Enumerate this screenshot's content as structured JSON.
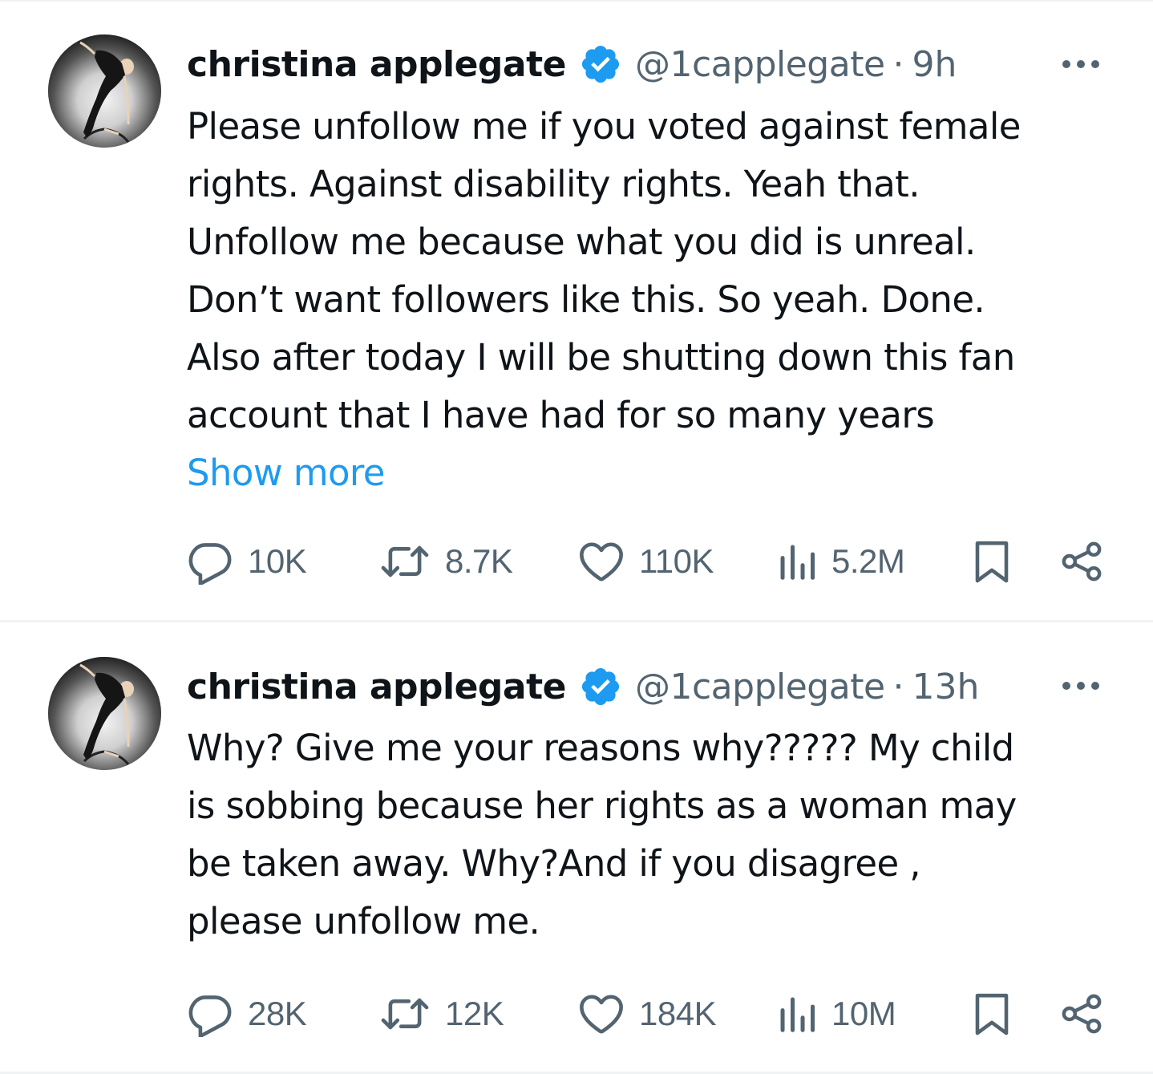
{
  "tweets": [
    {
      "display_name": "christina applegate",
      "handle": "@1capplegate",
      "separator": "·",
      "time": "9h",
      "body_lines": [
        "Please unfollow me if you voted against female",
        "rights. Against disability rights. Yeah that.",
        "Unfollow me because what you did is unreal.",
        "Don’t want followers like this. So yeah. Done.",
        "Also after today I will be shutting down this fan",
        "account that I have had for so many years"
      ],
      "show_more": "Show more",
      "replies": "10K",
      "retweets": "8.7K",
      "likes": "110K",
      "views": "5.2M"
    },
    {
      "display_name": "christina applegate",
      "handle": "@1capplegate",
      "separator": "·",
      "time": "13h",
      "body_lines": [
        "Why? Give me your reasons why????? My child",
        "is sobbing because her rights as a woman may",
        "be taken away. Why?And if you disagree ,",
        "please unfollow me."
      ],
      "replies": "28K",
      "retweets": "12K",
      "likes": "184K",
      "views": "10M"
    }
  ],
  "icons": {
    "verified": "verified-badge-icon",
    "more": "more-options-icon",
    "reply": "reply-icon",
    "retweet": "retweet-icon",
    "like": "heart-icon",
    "views": "analytics-icon",
    "bookmark": "bookmark-icon",
    "share": "share-icon"
  },
  "colors": {
    "text": "#0f1419",
    "secondary": "#536471",
    "link": "#1d9bf0",
    "divider": "#eff3f4"
  }
}
